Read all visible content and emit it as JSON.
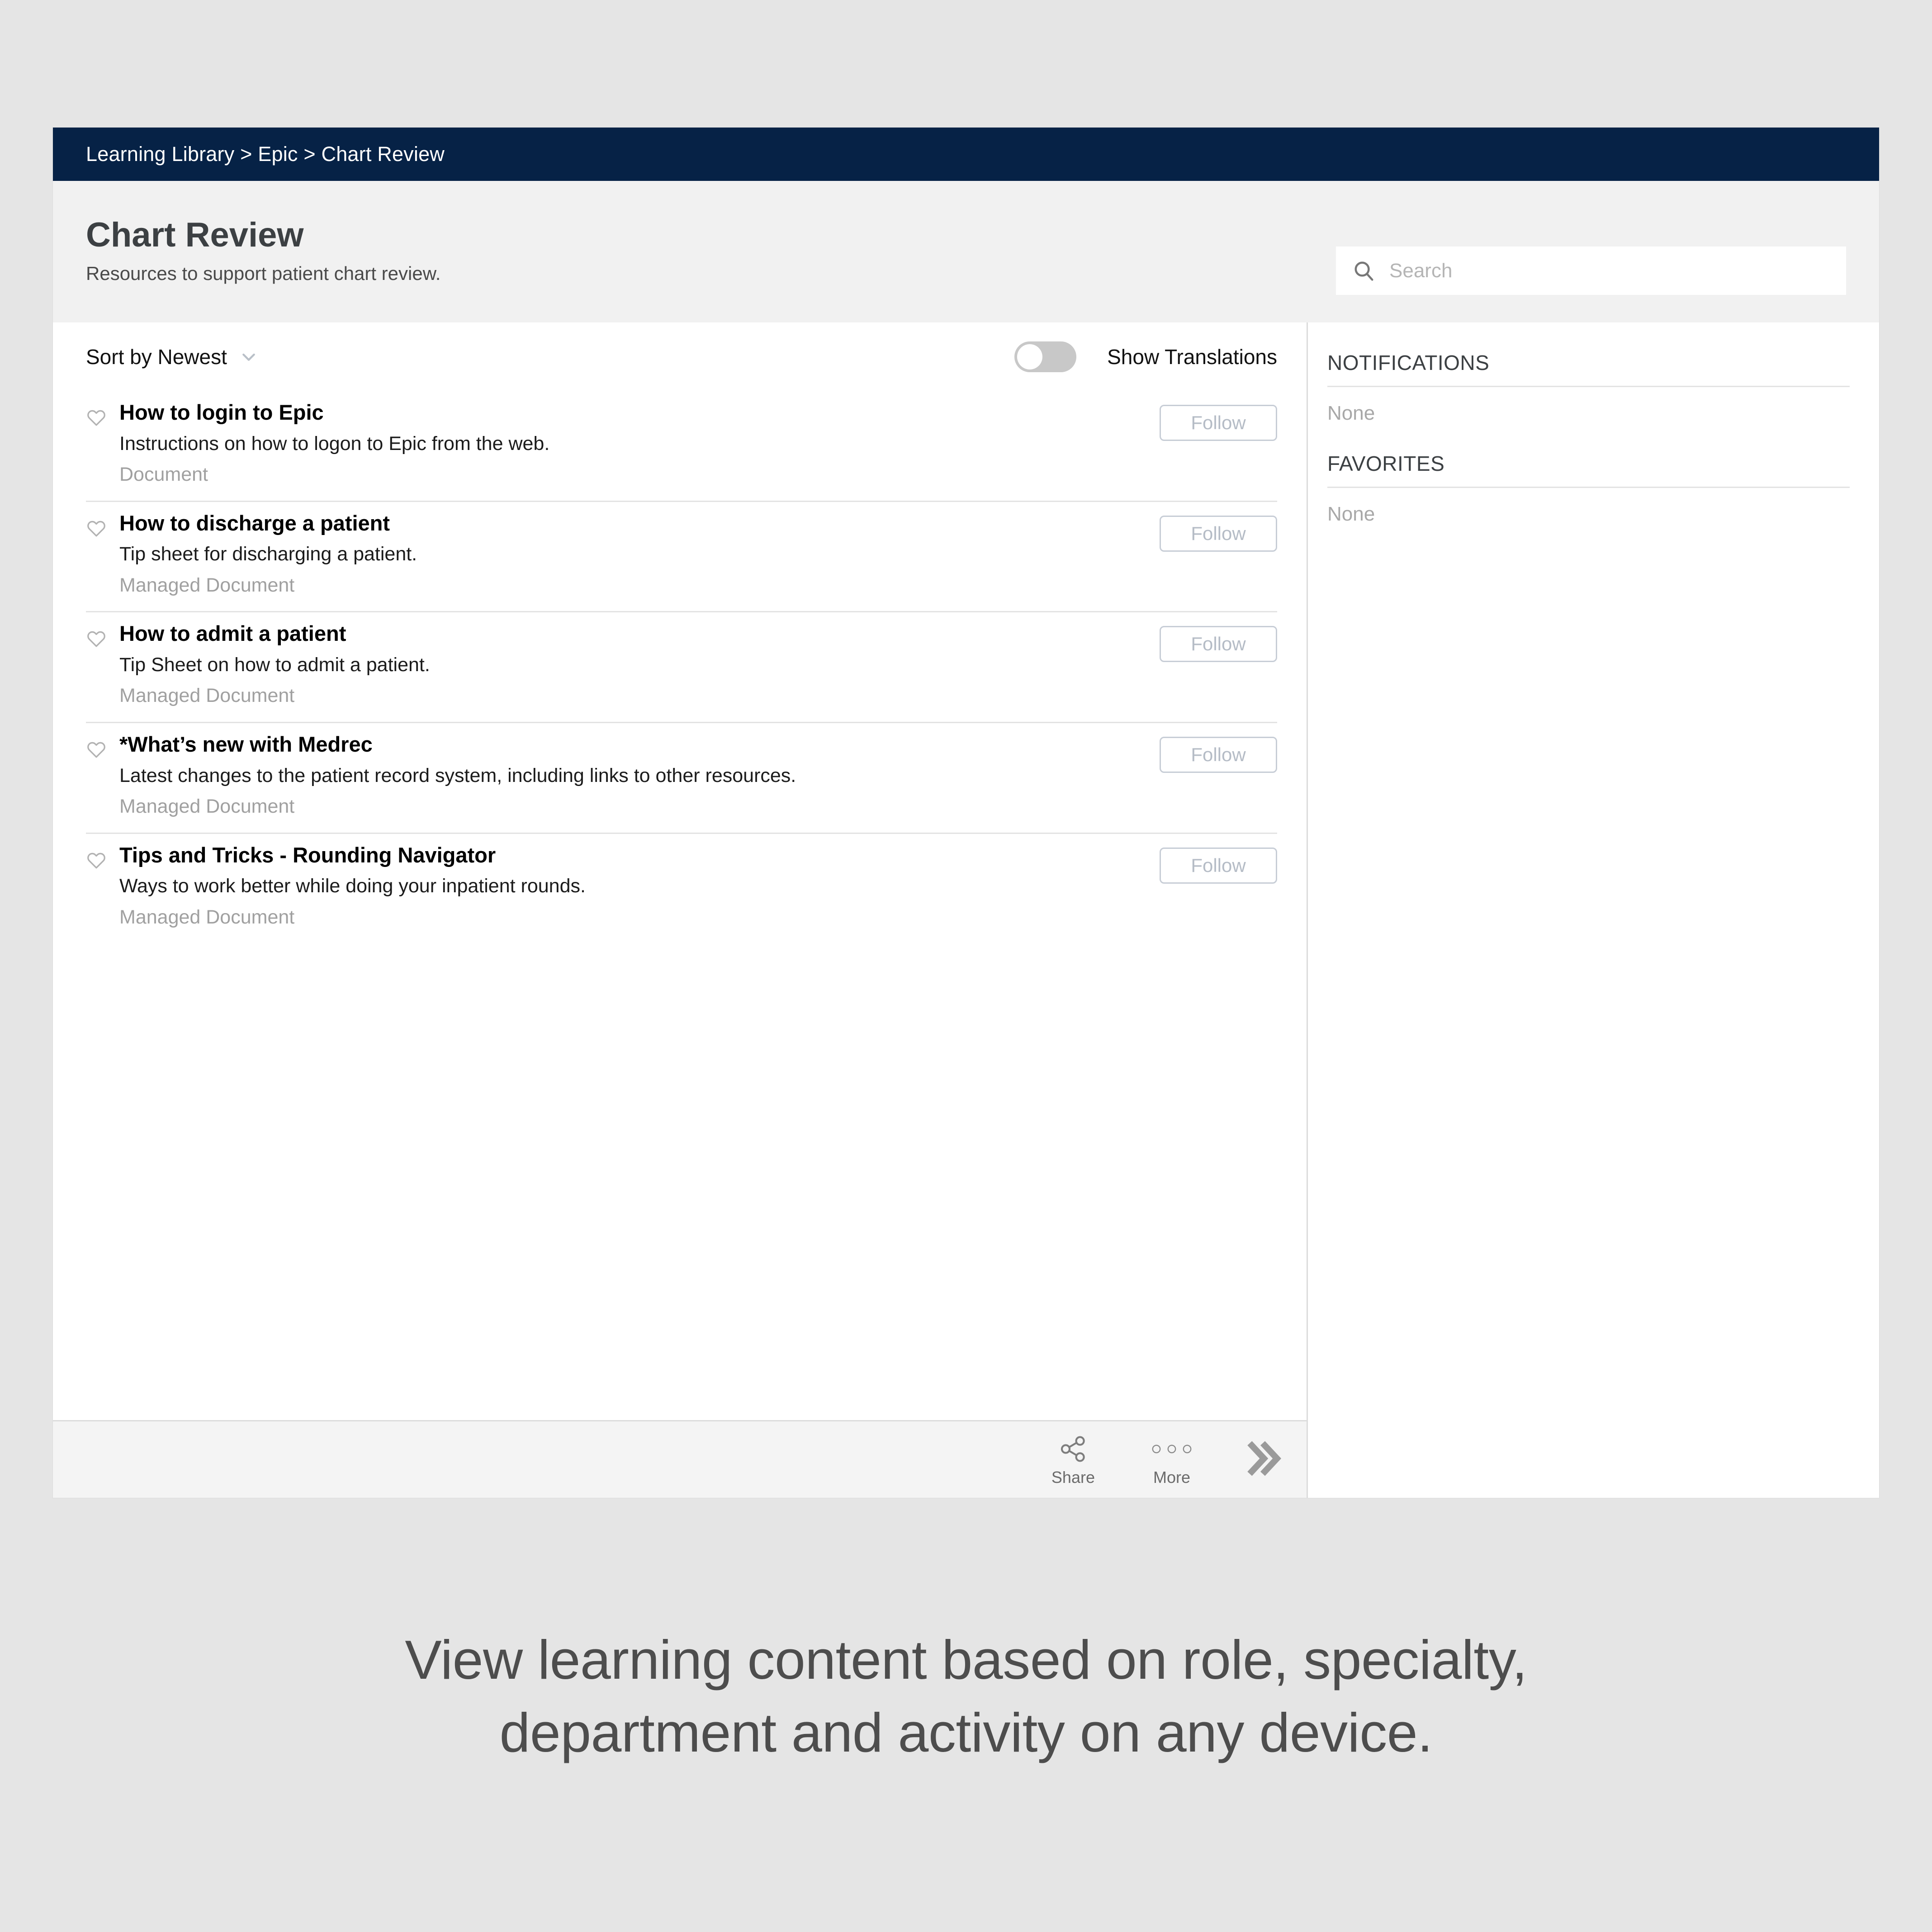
{
  "window": {
    "breadcrumb": "Learning Library > Epic > Chart Review",
    "breadcrumb_parts": [
      "Learning Library",
      "Epic",
      "Chart Review"
    ]
  },
  "header": {
    "title": "Chart Review",
    "subtitle": "Resources to support patient chart review."
  },
  "search": {
    "placeholder": "Search",
    "value": "",
    "icon": "search-icon"
  },
  "toolbar": {
    "sort_label": "Sort by Newest",
    "sort_chevron_icon": "chevron-down-icon",
    "translations_label": "Show Translations",
    "translations_enabled": false
  },
  "resources": [
    {
      "title": "How to login to Epic",
      "description": "Instructions on how to logon to Epic from the web.",
      "type": "Document",
      "follow_label": "Follow",
      "favorite_icon": "heart-outline-icon",
      "favorited": false
    },
    {
      "title": "How to discharge a patient",
      "description": "Tip sheet for discharging a patient.",
      "type": "Managed Document",
      "follow_label": "Follow",
      "favorite_icon": "heart-outline-icon",
      "favorited": false
    },
    {
      "title": "How to admit a patient",
      "description": "Tip Sheet on how to admit a patient.",
      "type": "Managed Document",
      "follow_label": "Follow",
      "favorite_icon": "heart-outline-icon",
      "favorited": false
    },
    {
      "title": "*What’s new with Medrec",
      "description": "Latest changes to the patient record system, including links to other resources.",
      "type": "Managed Document",
      "follow_label": "Follow",
      "favorite_icon": "heart-outline-icon",
      "favorited": false
    },
    {
      "title": "Tips and Tricks - Rounding Navigator",
      "description": "Ways to work better while doing your inpatient rounds.",
      "type": "Managed Document",
      "follow_label": "Follow",
      "favorite_icon": "heart-outline-icon",
      "favorited": false
    }
  ],
  "action_bar": {
    "share_label": "Share",
    "share_icon": "share-nodes-icon",
    "more_label": "More",
    "more_icon": "three-circles-icon",
    "expand_icon": "double-chevron-right-icon"
  },
  "rail": {
    "notifications": {
      "heading": "NOTIFICATIONS",
      "empty": "None"
    },
    "favorites": {
      "heading": "FAVORITES",
      "empty": "None"
    }
  },
  "caption": {
    "line1": "View learning content based on role, specialty,",
    "line2": "department and activity on any device."
  },
  "colors": {
    "brand_navy": "#062246",
    "page_background": "#e5e5e5",
    "header_gray": "#f1f1f1",
    "action_bar_gray": "#f4f4f4",
    "muted_text": "#a0a0a0",
    "divider": "#e3e3e3",
    "follow_border": "#c7cdd6"
  }
}
